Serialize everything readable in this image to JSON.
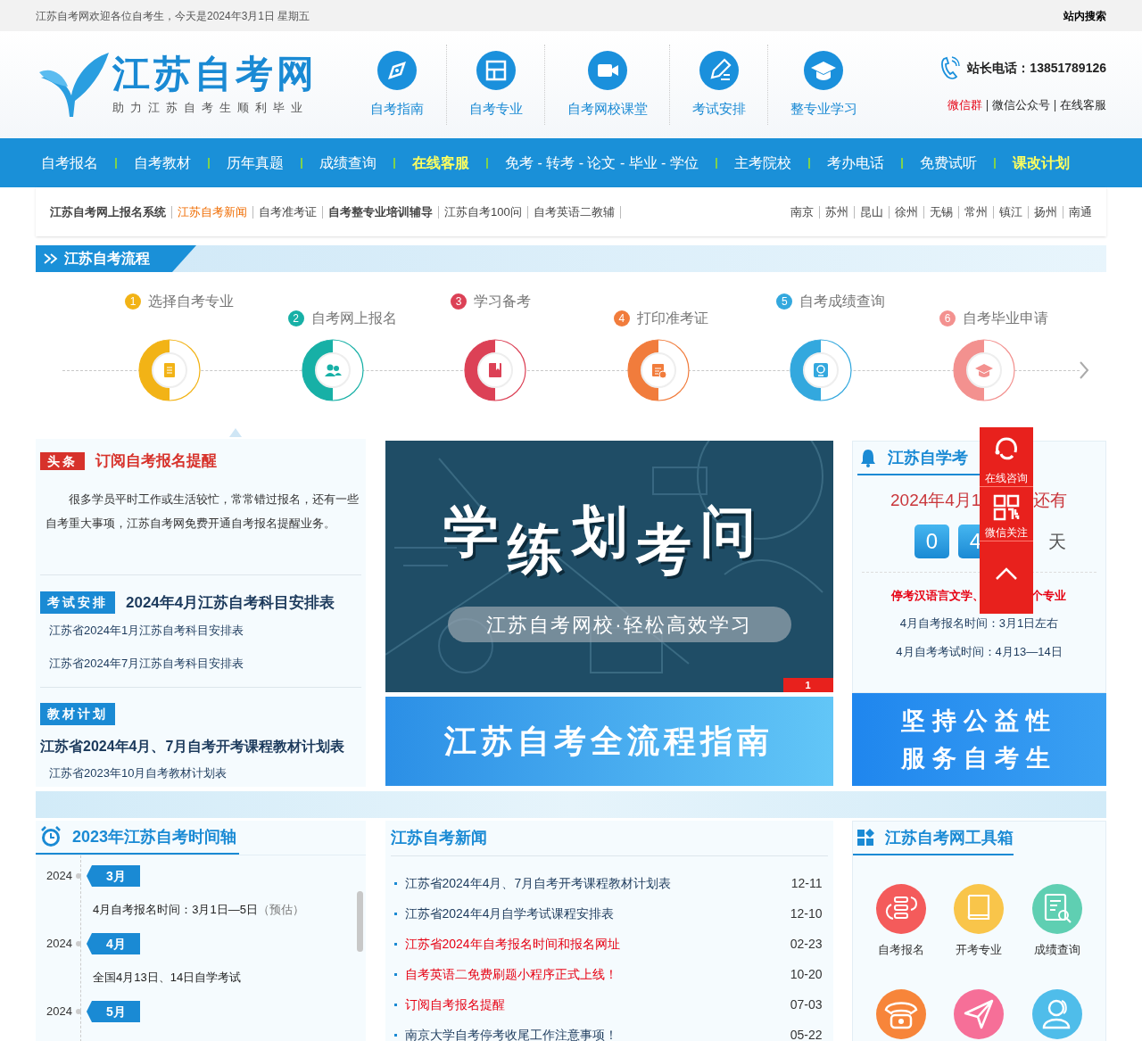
{
  "top_bar": {
    "welcome": "江苏自考网欢迎各位自考生，今天是2024年3月1日 星期五",
    "search_link": "站内搜索"
  },
  "header": {
    "logo_title": "江苏自考网",
    "logo_slogan": "助力江苏自考生顺利毕业",
    "quick_links": [
      {
        "label": "自考指南"
      },
      {
        "label": "自考专业"
      },
      {
        "label": "自考网校课堂"
      },
      {
        "label": "考试安排"
      },
      {
        "label": "整专业学习"
      }
    ],
    "phone": "站长电话：13851789126",
    "contact_links": [
      {
        "label": "微信群",
        "highlight": true
      },
      {
        "label": "微信公众号",
        "highlight": false
      },
      {
        "label": "在线客服",
        "highlight": false
      }
    ]
  },
  "main_nav": [
    {
      "label": "自考报名",
      "highlight": false
    },
    {
      "label": "自考教材",
      "highlight": false
    },
    {
      "label": "历年真题",
      "highlight": false
    },
    {
      "label": "成绩查询",
      "highlight": false
    },
    {
      "label": "在线客服",
      "highlight": true
    },
    {
      "label": "免考 - 转考 - 论文 - 毕业 - 学位",
      "highlight": false
    },
    {
      "label": "主考院校",
      "highlight": false
    },
    {
      "label": "考办电话",
      "highlight": false
    },
    {
      "label": "免费试听",
      "highlight": false
    },
    {
      "label": "课改计划",
      "highlight": true
    }
  ],
  "sub_nav": {
    "links": [
      {
        "label": "江苏自考网上报名系统",
        "bold": true,
        "highlight": false
      },
      {
        "label": "江苏自考新闻",
        "bold": false,
        "highlight": true
      },
      {
        "label": "自考准考证",
        "bold": false,
        "highlight": false
      },
      {
        "label": "自考整专业培训辅导",
        "bold": true,
        "highlight": false
      },
      {
        "label": "江苏自考100问",
        "bold": false,
        "highlight": false
      },
      {
        "label": "自考英语二教辅",
        "bold": false,
        "highlight": false
      }
    ],
    "cities": [
      "南京",
      "苏州",
      "昆山",
      "徐州",
      "无锡",
      "常州",
      "镇江",
      "扬州",
      "南通"
    ]
  },
  "flow": {
    "title": "江苏自考流程",
    "steps": [
      {
        "number": "1",
        "label": "选择自考专业",
        "color": "#f2b316"
      },
      {
        "number": "2",
        "label": "自考网上报名",
        "color": "#17b0a6"
      },
      {
        "number": "3",
        "label": "学习备考",
        "color": "#dc4156"
      },
      {
        "number": "4",
        "label": "打印准考证",
        "color": "#f17c3c"
      },
      {
        "number": "5",
        "label": "自考成绩查询",
        "color": "#33a8de"
      },
      {
        "number": "6",
        "label": "自考毕业申请",
        "color": "#f3918f"
      }
    ]
  },
  "headline": {
    "tag": "头条",
    "title": "订阅自考报名提醒",
    "text": "很多学员平时工作或生活较忙，常常错过报名，还有一些自考重大事项，江苏自考网免费开通自考报名提醒业务。"
  },
  "exam_schedule": {
    "tag": "考试安排",
    "title": "2024年4月江苏自考科目安排表",
    "links": [
      "江苏省2024年1月江苏自考科目安排表",
      "江苏省2024年7月江苏自考科目安排表"
    ]
  },
  "textbook_plan": {
    "tag": "教材计划",
    "title": "江苏省2024年4月、7月自考开考课程教材计划表",
    "links": [
      "江苏省2023年10月自考教材计划表"
    ]
  },
  "banner": {
    "words": [
      "学",
      "练",
      "划",
      "考",
      "问"
    ],
    "caption": "江苏自考网校·轻松高效学习",
    "slides": [
      {
        "label": "1",
        "selected": true
      }
    ]
  },
  "guide_banner": {
    "text": "江苏自考全流程指南"
  },
  "countdown": {
    "title": "江苏自学考",
    "lead": "2024年4月1",
    "trail": "还有",
    "digits": [
      "0",
      "4"
    ],
    "unit": "天",
    "notice_start": "停考汉语言文学、",
    "notice_end": "个专业",
    "lines": [
      "4月自考报名时间：3月1日左右",
      "4月自考考试时间：4月13—14日"
    ]
  },
  "slogan_banner": {
    "lines": [
      "坚持公益性",
      "服务自考生"
    ]
  },
  "float_panel": {
    "items": [
      {
        "label": "在线咨询"
      },
      {
        "label": "微信关注"
      }
    ]
  },
  "timeline": {
    "title": "2023年江苏自考时间轴",
    "entries": [
      {
        "year": "2024",
        "month": "3月",
        "text": "4月自考报名时间：3月1日—5日",
        "note": "（预估）"
      },
      {
        "year": "2024",
        "month": "4月",
        "text": "全国4月13日、14日自学考试"
      },
      {
        "year": "2024",
        "month": "5月"
      }
    ]
  },
  "news": {
    "title": "江苏自考新闻",
    "items": [
      {
        "title": "江苏省2024年4月、7月自考开考课程教材计划表",
        "date": "12-11",
        "highlight": false
      },
      {
        "title": "江苏省2024年4月自学考试课程安排表",
        "date": "12-10",
        "highlight": false
      },
      {
        "title": "江苏省2024年自考报名时间和报名网址",
        "date": "02-23",
        "highlight": true
      },
      {
        "title": "自考英语二免费刷题小程序正式上线！",
        "date": "10-20",
        "highlight": true
      },
      {
        "title": "订阅自考报名提醒",
        "date": "07-03",
        "highlight": true
      },
      {
        "title": "南京大学自考停考收尾工作注意事项！",
        "date": "05-22",
        "highlight": false
      }
    ]
  },
  "toolbox": {
    "title": "江苏自考网工具箱",
    "tools": [
      {
        "label": "自考报名",
        "color": "#f45b5b"
      },
      {
        "label": "开考专业",
        "color": "#f9c54a"
      },
      {
        "label": "成绩查询",
        "color": "#5fcfb2"
      },
      {
        "color": "#f7853a"
      },
      {
        "color": "#f66f98"
      },
      {
        "color": "#4fbdea"
      }
    ]
  }
}
